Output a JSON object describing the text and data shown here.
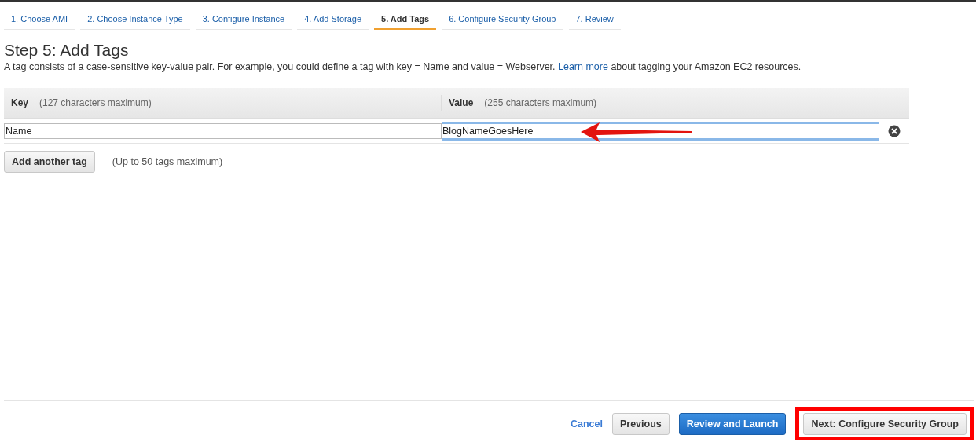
{
  "tabs": [
    {
      "label": "1. Choose AMI",
      "selected": false
    },
    {
      "label": "2. Choose Instance Type",
      "selected": false
    },
    {
      "label": "3. Configure Instance",
      "selected": false
    },
    {
      "label": "4. Add Storage",
      "selected": false
    },
    {
      "label": "5. Add Tags",
      "selected": true
    },
    {
      "label": "6. Configure Security Group",
      "selected": false
    },
    {
      "label": "7. Review",
      "selected": false
    }
  ],
  "title": "Step 5: Add Tags",
  "intro": {
    "before": "A tag consists of a case-sensitive key-value pair. For example, you could define a tag with key = Name and value = Webserver.",
    "link": "Learn more",
    "after": "about tagging your Amazon EC2 resources."
  },
  "table": {
    "columns": [
      {
        "label": "Key",
        "hint": "(127 characters maximum)"
      },
      {
        "label": "Value",
        "hint": "(255 characters maximum)"
      }
    ],
    "rows": [
      {
        "key": "Name",
        "value": "BlogNameGoesHere",
        "value_focused": true,
        "arrow": true
      }
    ]
  },
  "add_button": "Add another tag",
  "add_hint": "(Up to 50 tags maximum)",
  "footer": [
    {
      "kind": "link",
      "label": "Cancel",
      "highlighted": false
    },
    {
      "kind": "default",
      "label": "Previous",
      "highlighted": false
    },
    {
      "kind": "primary",
      "label": "Review and Launch",
      "highlighted": false
    },
    {
      "kind": "default",
      "label": "Next: Configure Security Group",
      "highlighted": true
    }
  ]
}
